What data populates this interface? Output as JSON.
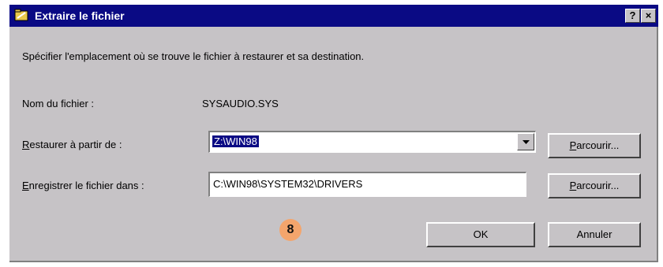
{
  "window": {
    "title": "Extraire le fichier",
    "help_label": "?",
    "close_label": "×"
  },
  "instruction": "Spécifier l'emplacement où se trouve le fichier à restaurer et sa destination.",
  "filename": {
    "label": "Nom du fichier :",
    "value": "SYSAUDIO.SYS"
  },
  "restore_from": {
    "accel": "R",
    "label_rest": "estaurer à partir de :",
    "value": "Z:\\WIN98",
    "browse_accel": "P",
    "browse_rest": "arcourir..."
  },
  "save_to": {
    "accel": "E",
    "label_rest": "nregistrer le fichier dans :",
    "value": "C:\\WIN98\\SYSTEM32\\DRIVERS",
    "browse_accel": "P",
    "browse_rest": "arcourir..."
  },
  "buttons": {
    "ok": "OK",
    "cancel": "Annuler"
  },
  "callout": "8",
  "colors": {
    "titlebar": "#0a0a84",
    "face": "#c6c3c6",
    "badge": "#f4a56c"
  }
}
